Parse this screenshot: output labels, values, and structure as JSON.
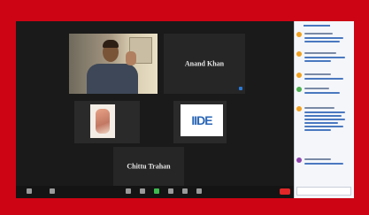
{
  "participants": [
    {
      "name": "Anand Khan"
    },
    {
      "name": "Chittu Trahan"
    }
  ],
  "colors": {
    "frame_red": "#cc0414",
    "meeting_bg": "#1a1a1a",
    "tile_bg": "#262626",
    "chat_bg": "#f4f6fa",
    "accent_blue": "#2a78d6",
    "leave_red": "#e02828"
  },
  "logo": {
    "text": "IIDE"
  },
  "toolbar": {
    "icons": [
      "mic-icon",
      "video-icon",
      "participants-icon",
      "chat-icon",
      "share-icon",
      "record-icon",
      "reactions-icon",
      "more-icon"
    ],
    "leave_icon": "leave-icon"
  },
  "chat": {
    "avatar_colors": [
      "#f0a020",
      "#f0a020",
      "#4caf50",
      "#f0a020",
      "#8e44ad"
    ]
  }
}
